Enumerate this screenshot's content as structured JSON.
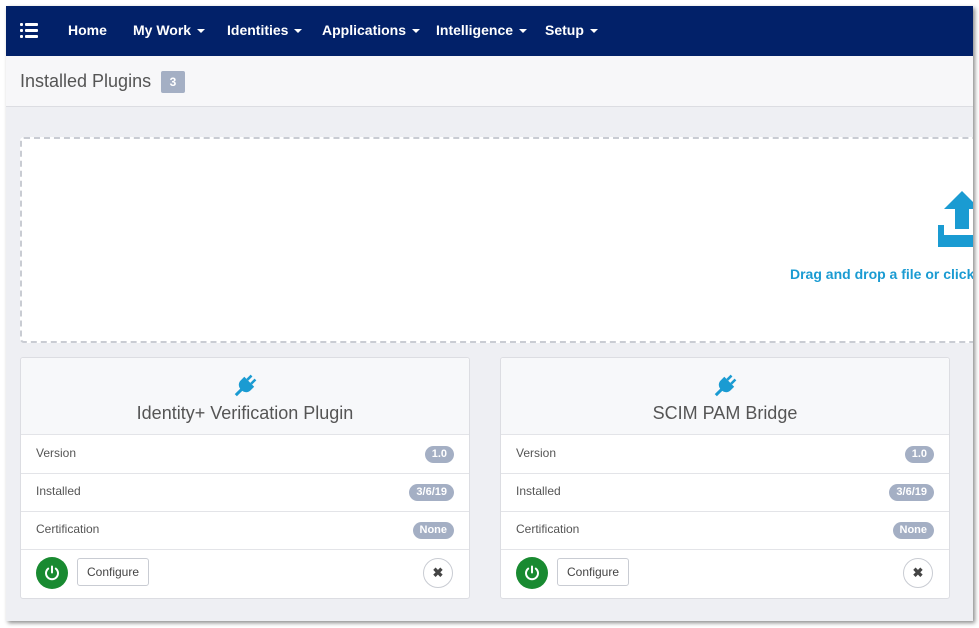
{
  "nav": {
    "menu_icon": "hamburger-list-icon",
    "items": [
      {
        "label": "Home",
        "dropdown": false
      },
      {
        "label": "My Work",
        "dropdown": true
      },
      {
        "label": "Identities",
        "dropdown": true
      },
      {
        "label": "Applications",
        "dropdown": true
      },
      {
        "label": "Intelligence",
        "dropdown": true
      },
      {
        "label": "Setup",
        "dropdown": true
      }
    ],
    "background_color": "#022169"
  },
  "page": {
    "title": "Installed Plugins",
    "count": "3"
  },
  "dropzone": {
    "icon": "upload-icon",
    "text": "Drag and drop a file or click i",
    "accent_color": "#1a9bd2"
  },
  "plugins": [
    {
      "icon": "plug-icon",
      "name": "Identity+ Verification Plugin",
      "rows": [
        {
          "label": "Version",
          "value": "1.0"
        },
        {
          "label": "Installed",
          "value": "3/6/19"
        },
        {
          "label": "Certification",
          "value": "None"
        }
      ],
      "configure_label": "Configure",
      "remove_symbol": "✖"
    },
    {
      "icon": "plug-icon",
      "name": "SCIM PAM Bridge",
      "rows": [
        {
          "label": "Version",
          "value": "1.0"
        },
        {
          "label": "Installed",
          "value": "3/6/19"
        },
        {
          "label": "Certification",
          "value": "None"
        }
      ],
      "configure_label": "Configure",
      "remove_symbol": "✖"
    }
  ],
  "colors": {
    "power_button": "#198a31",
    "badge": "#a4afc4"
  }
}
